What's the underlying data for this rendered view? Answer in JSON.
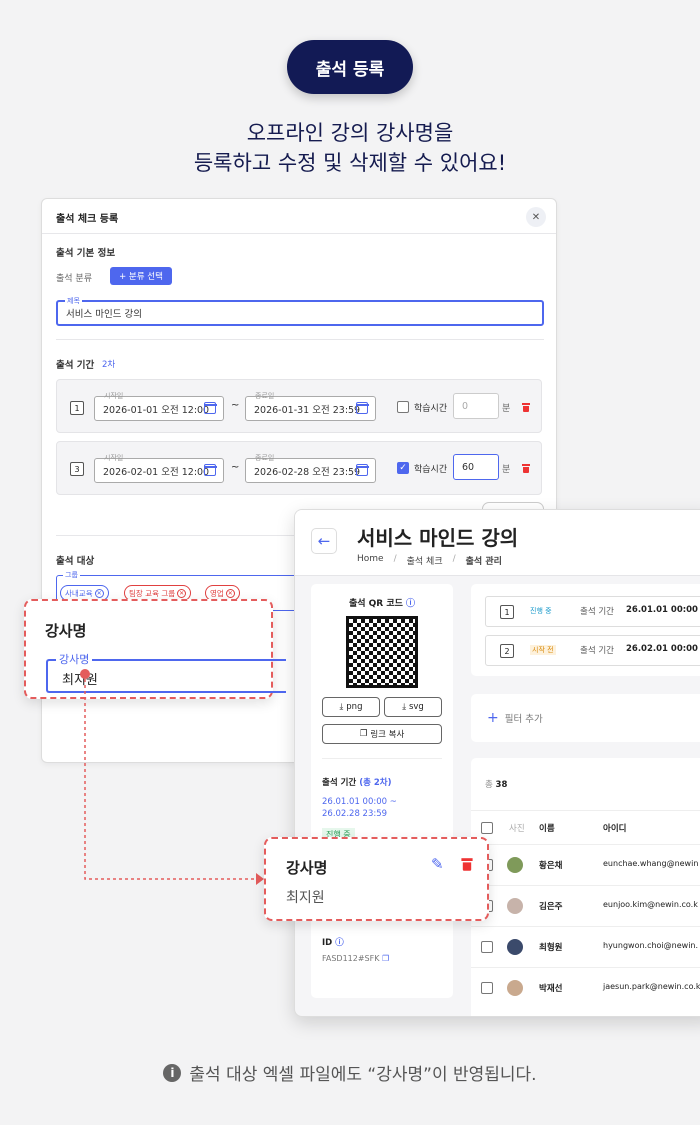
{
  "badge": "출석 등록",
  "headline": [
    "오프라인 강의 강사명을",
    "등록하고 수정 및 삭제할 수 있어요!"
  ],
  "form": {
    "title": "출석 체크 등록",
    "close": "✕",
    "basic_section": "출석 기본 정보",
    "category_label": "출석 분류",
    "category_button": "+ 분류 선택",
    "title_field_label": "제목",
    "title_field_value": "서비스 마인드 강의",
    "period_section": "출석 기간",
    "period_count": "2차",
    "start_label": "시작일",
    "end_label": "종료일",
    "study_time_label": "학습시간",
    "minute_unit": "분",
    "tilde": "~",
    "periods": [
      {
        "num": "1",
        "start": "2026-01-01 오전 12:00",
        "end": "2026-01-31 오전 23:59",
        "checked": false,
        "minutes": "0"
      },
      {
        "num": "3",
        "start": "2026-02-01 오전 12:00",
        "end": "2026-02-28 오전 23:59",
        "checked": true,
        "minutes": "60"
      }
    ],
    "target_section": "출석 대상",
    "group_label": "그룹",
    "chips": [
      "사내교육",
      "팀장 교육 그룹",
      "영업"
    ]
  },
  "instructor_popup_1": {
    "title": "강사명",
    "field_label": "강사명",
    "field_value": "최지원"
  },
  "instructor_popup_2": {
    "title": "강사명",
    "value": "최지원"
  },
  "detail": {
    "title": "서비스 마인드 강의",
    "breadcrumb": [
      "Home",
      "출석 체크",
      "출석 관리"
    ],
    "breadcrumb_sep": "/",
    "qr_label": "출석 QR 코드",
    "png": "png",
    "svg": "svg",
    "copy_link": "링크 복사",
    "period_label": "출석 기간",
    "period_total": "(총 2차)",
    "period_range": [
      "26.01.01 00:00 ~",
      "26.02.28 23:59"
    ],
    "status_in_progress": "진행 중",
    "id_label": "ID",
    "id_value": "FASD112#SFK",
    "sessions": [
      {
        "num": "1",
        "status": "진행 중",
        "label": "출석 기간",
        "date": "26.01.01 00:00 -"
      },
      {
        "num": "2",
        "status": "시작 전",
        "label": "출석 기간",
        "date": "26.02.01 00:00"
      }
    ],
    "filter_add": "필터 추가",
    "total_label": "총",
    "total_count": "38",
    "col_photo": "사진",
    "col_name": "이름",
    "col_id": "아이디",
    "rows": [
      {
        "name": "황은채",
        "email": "eunchae.whang@newin"
      },
      {
        "name": "김은주",
        "email": "eunjoo.kim@newin.co.k"
      },
      {
        "name": "최형원",
        "email": "hyungwon.choi@newin."
      },
      {
        "name": "박재선",
        "email": "jaesun.park@newin.co.k"
      }
    ]
  },
  "footer": "출석 대상 엑셀 파일에도 “강사명”이 반영됩니다.",
  "colors": {
    "primary": "#4e67ee",
    "navy": "#121a55",
    "danger": "#e04040"
  }
}
